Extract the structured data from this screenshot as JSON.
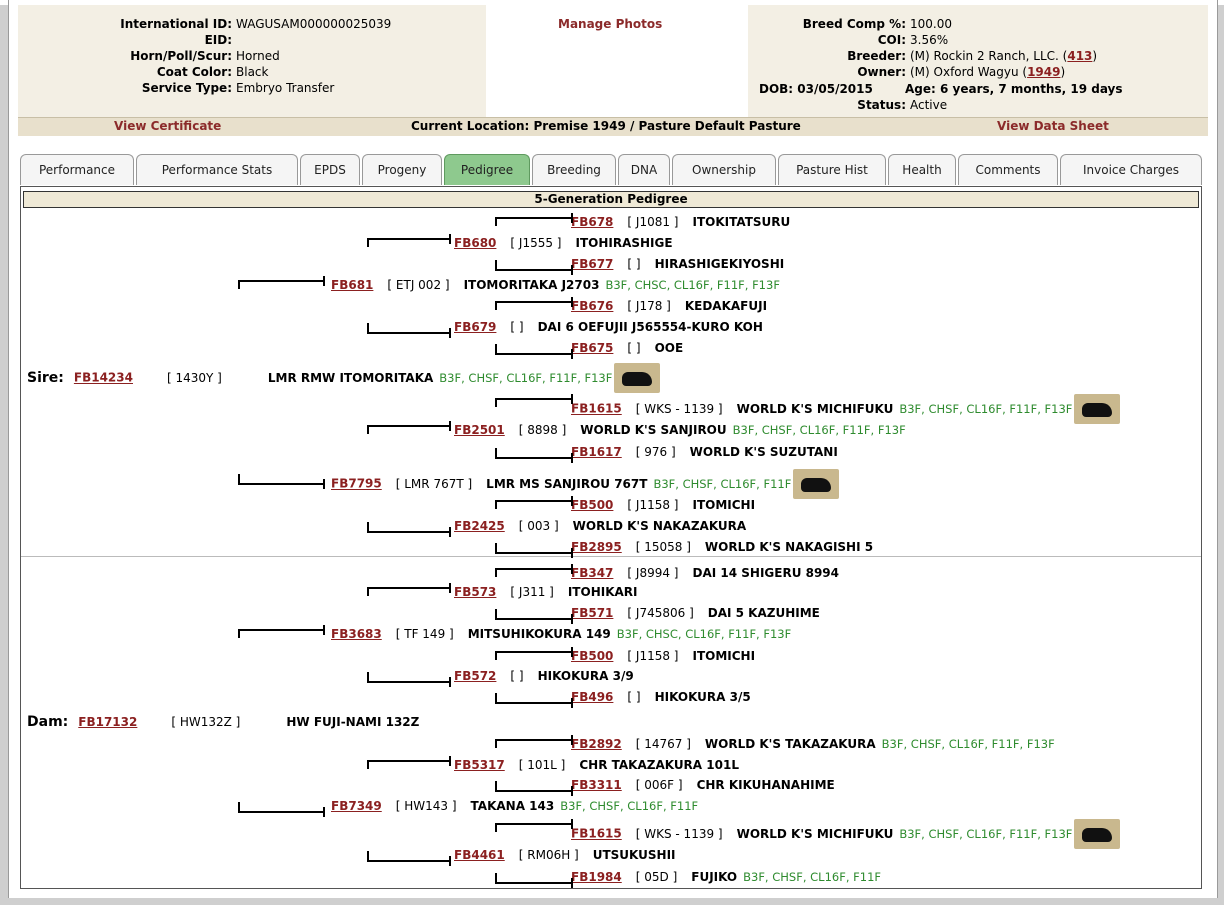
{
  "header": {
    "international_id_label": "International ID:",
    "international_id": "WAGUSAM000000025039",
    "eid_label": "EID:",
    "eid": "",
    "horn_label": "Horn/Poll/Scur:",
    "horn": "Horned",
    "coat_label": "Coat Color:",
    "coat": "Black",
    "service_label": "Service Type:",
    "service": "Embryo Transfer",
    "manage_photos": "Manage Photos",
    "breed_comp_label": "Breed Comp %:",
    "breed_comp": "100.00",
    "coi_label": "COI:",
    "coi": "3.56%",
    "breeder_label": "Breeder:",
    "breeder": "(M) Rockin 2 Ranch, LLC. (",
    "breeder_link": "413",
    "owner_label": "Owner:",
    "owner": "(M) Oxford Wagyu (",
    "owner_link": "1949",
    "close_paren": ")",
    "dob": "DOB: 03/05/2015",
    "age": "Age: 6 years, 7 months, 19 days",
    "status_label": "Status:",
    "status": "Active"
  },
  "actions": {
    "view_certificate": "View Certificate",
    "location": "Current Location: Premise 1949 / Pasture Default Pasture",
    "view_data_sheet": "View Data Sheet"
  },
  "tabs": [
    "Performance",
    "Performance Stats",
    "EPDS",
    "Progeny",
    "Pedigree",
    "Breeding",
    "DNA",
    "Ownership",
    "Pasture Hist",
    "Health",
    "Comments",
    "Invoice Charges"
  ],
  "active_tab": "Pedigree",
  "pedigree_title": "5-Generation Pedigree",
  "sire_label": "Sire:",
  "dam_label": "Dam:",
  "nodes": [
    {
      "id": "FB678",
      "reg": "[ J1081 ]",
      "name": "ITOKITATSURU",
      "gen": ""
    },
    {
      "id": "FB680",
      "reg": "[ J1555 ]",
      "name": "ITOHIRASHIGE",
      "gen": ""
    },
    {
      "id": "FB677",
      "reg": "[ ]",
      "name": "HIRASHIGEKIYOSHI",
      "gen": ""
    },
    {
      "id": "FB681",
      "reg": "[ ETJ 002 ]",
      "name": "ITOMORITAKA J2703",
      "gen": "B3F, CHSC, CL16F, F11F, F13F"
    },
    {
      "id": "FB676",
      "reg": "[ J178 ]",
      "name": "KEDAKAFUJI",
      "gen": ""
    },
    {
      "id": "FB679",
      "reg": "[ ]",
      "name": "DAI 6 OEFUJII J565554-KURO KOH",
      "gen": ""
    },
    {
      "id": "FB675",
      "reg": "[ ]",
      "name": "OOE",
      "gen": ""
    },
    {
      "id": "FB14234",
      "reg": "[ 1430Y ]",
      "name": "LMR RMW ITOMORITAKA",
      "gen": "B3F, CHSF, CL16F, F11F, F13F"
    },
    {
      "id": "FB1615",
      "reg": "[ WKS - 1139 ]",
      "name": "WORLD K'S MICHIFUKU",
      "gen": "B3F, CHSF, CL16F, F11F, F13F"
    },
    {
      "id": "FB2501",
      "reg": "[ 8898 ]",
      "name": "WORLD K'S SANJIROU",
      "gen": "B3F, CHSF, CL16F, F11F, F13F"
    },
    {
      "id": "FB1617",
      "reg": "[ 976 ]",
      "name": "WORLD K'S SUZUTANI",
      "gen": ""
    },
    {
      "id": "FB7795",
      "reg": "[ LMR 767T ]",
      "name": "LMR MS SANJIROU 767T",
      "gen": "B3F, CHSF, CL16F, F11F"
    },
    {
      "id": "FB500",
      "reg": "[ J1158 ]",
      "name": "ITOMICHI",
      "gen": ""
    },
    {
      "id": "FB2425",
      "reg": "[ 003 ]",
      "name": "WORLD K'S NAKAZAKURA",
      "gen": ""
    },
    {
      "id": "FB2895",
      "reg": "[ 15058 ]",
      "name": "WORLD K'S NAKAGISHI 5",
      "gen": ""
    },
    {
      "id": "FB347",
      "reg": "[ J8994 ]",
      "name": "DAI 14 SHIGERU 8994",
      "gen": ""
    },
    {
      "id": "FB573",
      "reg": "[ J311 ]",
      "name": "ITOHIKARI",
      "gen": ""
    },
    {
      "id": "FB571",
      "reg": "[ J745806 ]",
      "name": "DAI 5 KAZUHIME",
      "gen": ""
    },
    {
      "id": "FB3683",
      "reg": "[ TF 149 ]",
      "name": "MITSUHIKOKURA 149",
      "gen": "B3F, CHSC, CL16F, F11F, F13F"
    },
    {
      "id": "FB500",
      "reg": "[ J1158 ]",
      "name": "ITOMICHI",
      "gen": ""
    },
    {
      "id": "FB572",
      "reg": "[ ]",
      "name": "HIKOKURA 3/9",
      "gen": ""
    },
    {
      "id": "FB496",
      "reg": "[ ]",
      "name": "HIKOKURA 3/5",
      "gen": ""
    },
    {
      "id": "FB17132",
      "reg": "[ HW132Z ]",
      "name": "HW FUJI-NAMI 132Z",
      "gen": ""
    },
    {
      "id": "FB2892",
      "reg": "[ 14767 ]",
      "name": "WORLD K'S TAKAZAKURA",
      "gen": "B3F, CHSF, CL16F, F11F, F13F"
    },
    {
      "id": "FB5317",
      "reg": "[ 101L ]",
      "name": "CHR TAKAZAKURA 101L",
      "gen": ""
    },
    {
      "id": "FB3311",
      "reg": "[ 006F ]",
      "name": "CHR KIKUHANAHIME",
      "gen": ""
    },
    {
      "id": "FB7349",
      "reg": "[ HW143 ]",
      "name": "TAKANA 143",
      "gen": "B3F, CHSF, CL16F, F11F"
    },
    {
      "id": "FB1615",
      "reg": "[ WKS - 1139 ]",
      "name": "WORLD K'S MICHIFUKU",
      "gen": "B3F, CHSF, CL16F, F11F, F13F"
    },
    {
      "id": "FB4461",
      "reg": "[ RM06H ]",
      "name": "UTSUKUSHII",
      "gen": ""
    },
    {
      "id": "FB1984",
      "reg": "[ 05D ]",
      "name": "FUJIKO",
      "gen": "B3F, CHSF, CL16F, F11F"
    }
  ]
}
